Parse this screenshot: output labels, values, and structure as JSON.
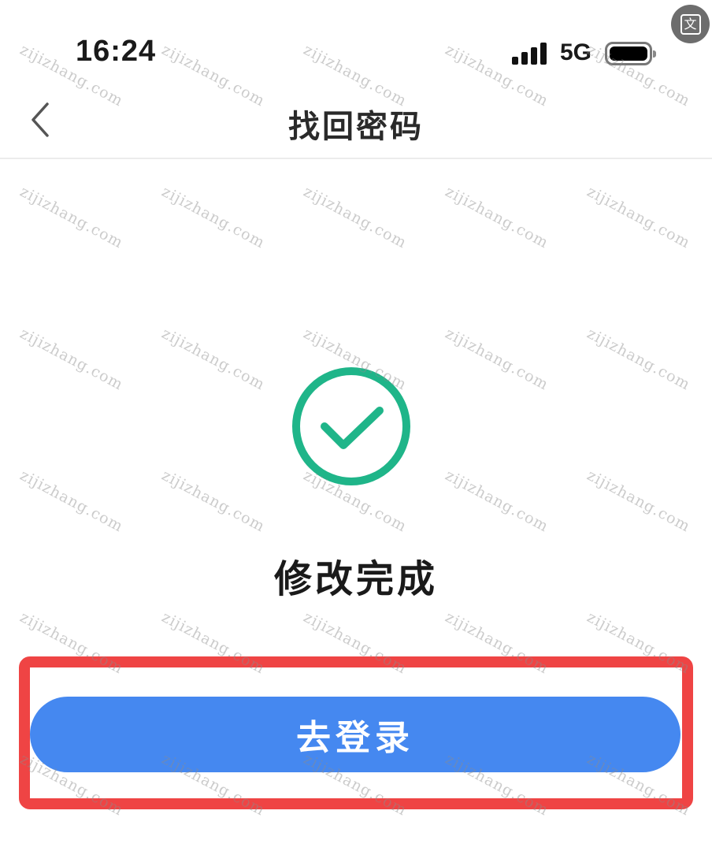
{
  "status_bar": {
    "time": "16:24",
    "network": "5G",
    "signal_bars": 4,
    "battery_icon": "battery-full-icon"
  },
  "translate_button": {
    "icon": "translate-icon",
    "glyph": "文"
  },
  "nav": {
    "back_icon": "chevron-left-icon",
    "title": "找回密码"
  },
  "result": {
    "icon": "check-circle-icon",
    "icon_color": "#1fb589",
    "message": "修改完成"
  },
  "action": {
    "login_label": "去登录",
    "button_color": "#4588f0",
    "highlight_color": "#ef4444"
  },
  "watermark": {
    "text": "zijizhang.com"
  }
}
